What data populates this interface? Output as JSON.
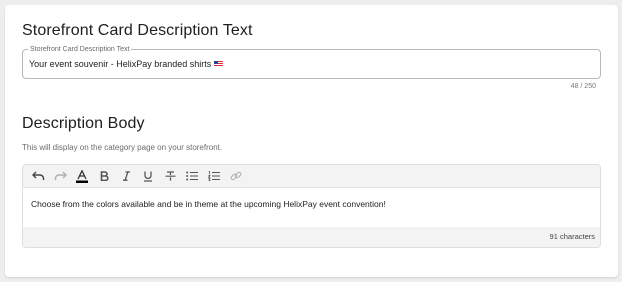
{
  "section1": {
    "heading": "Storefront Card Description Text",
    "field_label": "Storefront Card Description Text",
    "field_value": "Your event souvenir - HelixPay branded shirts",
    "flag_icon": "us-flag-emoji",
    "counter": "48 / 250"
  },
  "section2": {
    "heading": "Description Body",
    "subtext": "This will display on the category page on your storefront.",
    "toolbar": {
      "items": [
        {
          "name": "undo",
          "icon": "undo-icon",
          "enabled": true
        },
        {
          "name": "redo",
          "icon": "redo-icon",
          "enabled": false
        },
        {
          "name": "text-color",
          "icon": "font-color-icon",
          "label": "A",
          "color": "#000000"
        },
        {
          "name": "bold",
          "icon": "bold-icon",
          "label": "B"
        },
        {
          "name": "italic",
          "icon": "italic-icon",
          "label": "I"
        },
        {
          "name": "underline",
          "icon": "underline-icon",
          "label": "U"
        },
        {
          "name": "strikethrough",
          "icon": "strikethrough-icon",
          "label": "S"
        },
        {
          "name": "bulleted-list",
          "icon": "bulleted-list-icon"
        },
        {
          "name": "numbered-list",
          "icon": "numbered-list-icon"
        },
        {
          "name": "link",
          "icon": "link-icon",
          "enabled": false
        }
      ]
    },
    "content": "Choose from the colors available and be in theme at the upcoming HelixPay event convention!",
    "char_count": "91 characters"
  },
  "colors": {
    "background": "#eeeeee",
    "card": "#ffffff",
    "toolbar_bg": "#f3f3f3",
    "border": "#b8b8b8"
  }
}
